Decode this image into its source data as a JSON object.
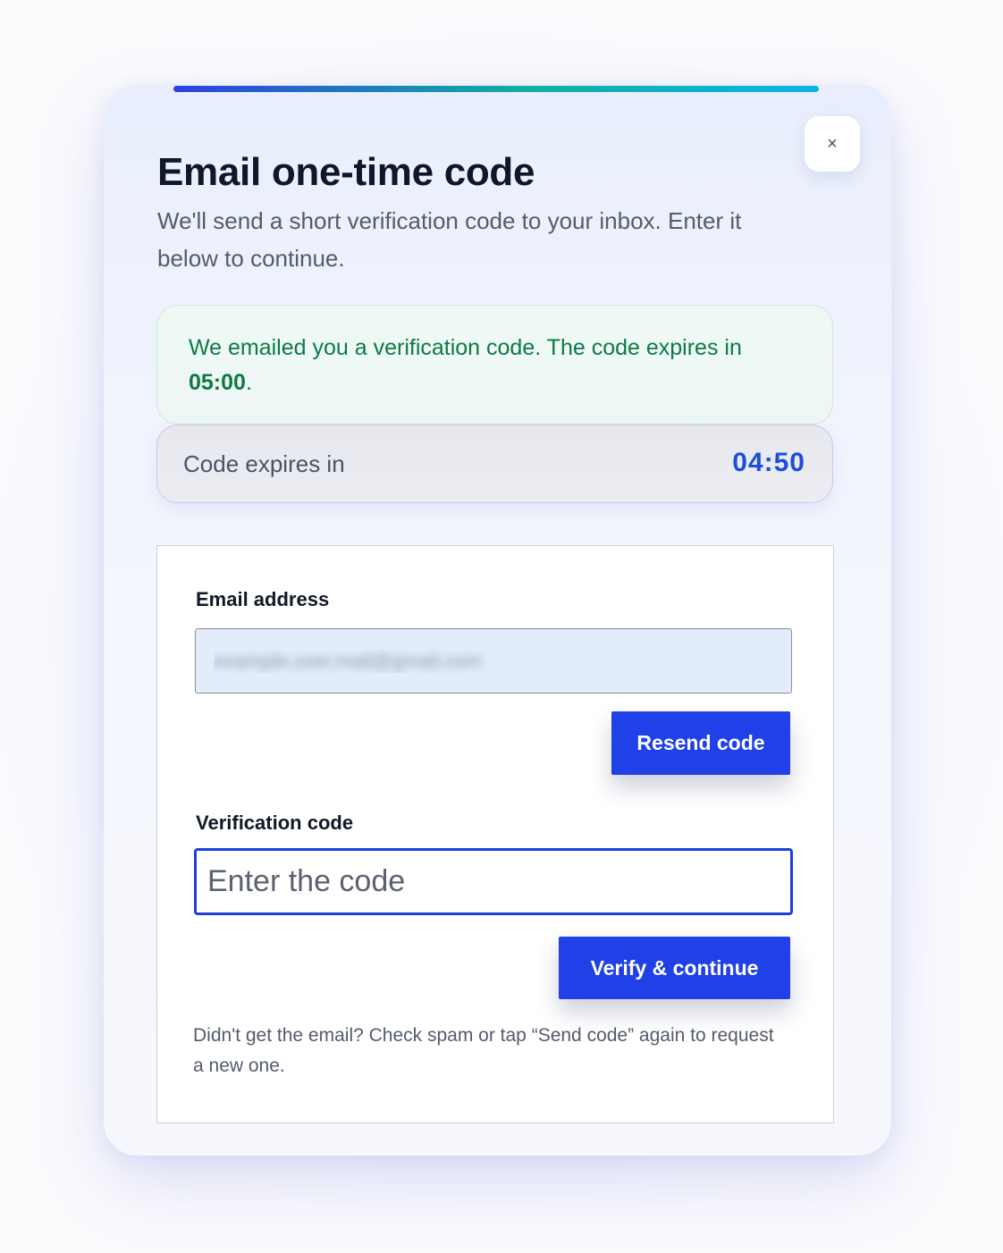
{
  "dialog": {
    "title": "Email one-time code",
    "subtitle": "We'll send a short verification code to your inbox. Enter it below to continue.",
    "close_label": "×"
  },
  "notice": {
    "text_before": "We emailed you a verification code. The code expires in ",
    "expiry_bold": "05:00",
    "text_after": "."
  },
  "timer": {
    "label": "Code expires in",
    "value": "04:50"
  },
  "form": {
    "email_label": "Email address",
    "email_value": "example.user.mail@gmail.com",
    "resend_label": "Resend code",
    "code_label": "Verification code",
    "code_placeholder": "Enter the code",
    "code_value": "",
    "verify_label": "Verify & continue",
    "help_text": "Didn't get the email? Check spam or tap “Send code” again to request a new one."
  },
  "colors": {
    "primary": "#2040e8",
    "success": "#0d7a46",
    "timer": "#1d4ed8"
  }
}
